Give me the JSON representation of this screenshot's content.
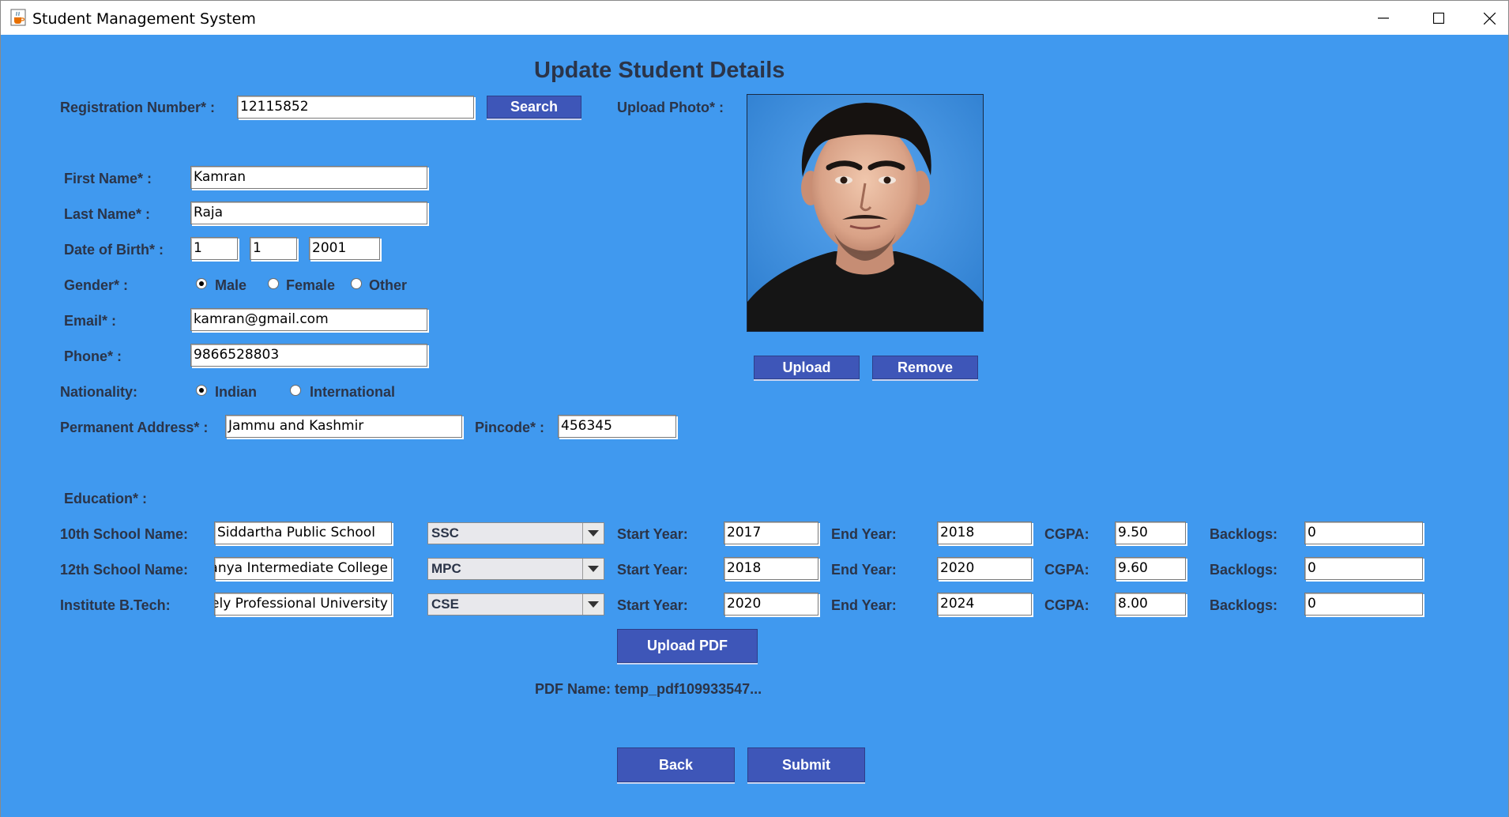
{
  "window": {
    "title": "Student Management System",
    "app_icon": "java-cup-icon"
  },
  "form": {
    "heading": "Update Student Details",
    "registration": {
      "label": "Registration Number* :",
      "value": "12115852",
      "search_label": "Search"
    },
    "photo": {
      "label": "Upload Photo* :",
      "upload_label": "Upload",
      "remove_label": "Remove"
    },
    "first_name": {
      "label": "First Name* :",
      "value": "Kamran"
    },
    "last_name": {
      "label": "Last Name* :",
      "value": "Raja"
    },
    "dob": {
      "label": "Date of Birth* :",
      "day": "1",
      "month": "1",
      "year": "2001"
    },
    "gender": {
      "label": "Gender* :",
      "options": [
        "Male",
        "Female",
        "Other"
      ],
      "selected": "Male"
    },
    "email": {
      "label": "Email* :",
      "value": "kamran@gmail.com"
    },
    "phone": {
      "label": "Phone* :",
      "value": "9866528803"
    },
    "nationality": {
      "label": "Nationality:",
      "options": [
        "Indian",
        "International"
      ],
      "selected": "Indian"
    },
    "address": {
      "label": "Permanent Address* :",
      "value": "Jammu and Kashmir"
    },
    "pincode": {
      "label": "Pincode* :",
      "value": "456345"
    },
    "education": {
      "label": "Education* :",
      "start_label": "Start Year:",
      "end_label": "End Year:",
      "cgpa_label": "CGPA:",
      "backlogs_label": "Backlogs:",
      "rows": [
        {
          "label": "10th School Name:",
          "school": "Siddartha Public School",
          "stream": "SSC",
          "start": "2017",
          "end": "2018",
          "cgpa": "9.50",
          "backlogs": "0"
        },
        {
          "label": "12th School Name:",
          "school": "itanya Intermediate College",
          "stream": "MPC",
          "start": "2018",
          "end": "2020",
          "cgpa": "9.60",
          "backlogs": "0"
        },
        {
          "label": "Institute B.Tech:",
          "school": "vely Professional University",
          "stream": "CSE",
          "start": "2020",
          "end": "2024",
          "cgpa": "8.00",
          "backlogs": "0"
        }
      ]
    },
    "upload_pdf_label": "Upload PDF",
    "pdf_name": "PDF Name: temp_pdf109933547...",
    "back_label": "Back",
    "submit_label": "Submit"
  },
  "colors": {
    "background": "#4099ef",
    "button": "#3e56b8",
    "label": "#2b3448"
  }
}
